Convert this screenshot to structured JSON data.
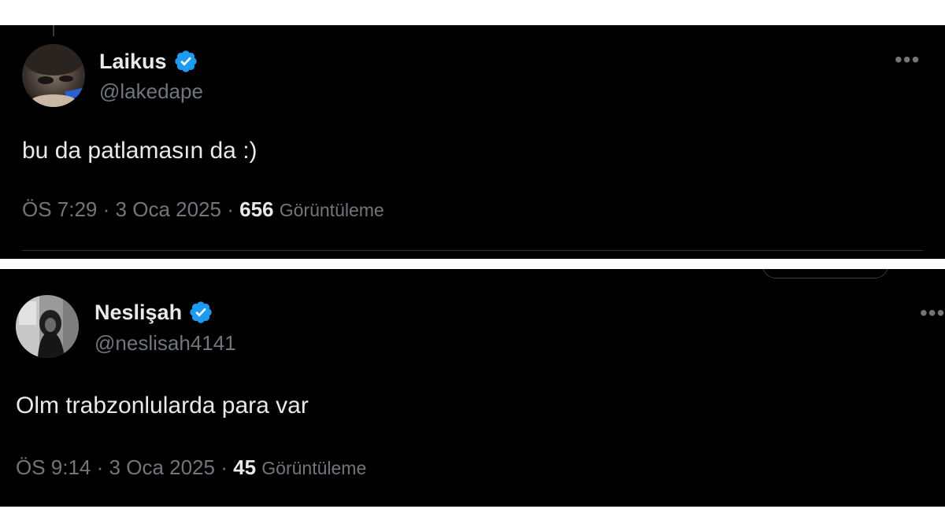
{
  "tweets": [
    {
      "display_name": "Laikus",
      "handle": "@lakedape",
      "text": "bu da patlamasın da :)",
      "time": "ÖS 7:29",
      "date": "3 Oca 2025",
      "separator": "·",
      "views_count": "656",
      "views_label": "Görüntüleme",
      "verified": true,
      "more_icon": "more-horizontal-icon"
    },
    {
      "display_name": "Neslişah",
      "handle": "@neslisah4141",
      "text": "Olm trabzonlularda para var",
      "time": "ÖS 9:14",
      "date": "3 Oca 2025",
      "separator": "·",
      "views_count": "45",
      "views_label": "Görüntüleme",
      "verified": true,
      "more_icon": "more-horizontal-icon"
    }
  ],
  "colors": {
    "background": "#000000",
    "primary_text": "#e7e9ea",
    "secondary_text": "#71767b",
    "verified_badge": "#1d9bf0",
    "divider": "#2f3336"
  }
}
